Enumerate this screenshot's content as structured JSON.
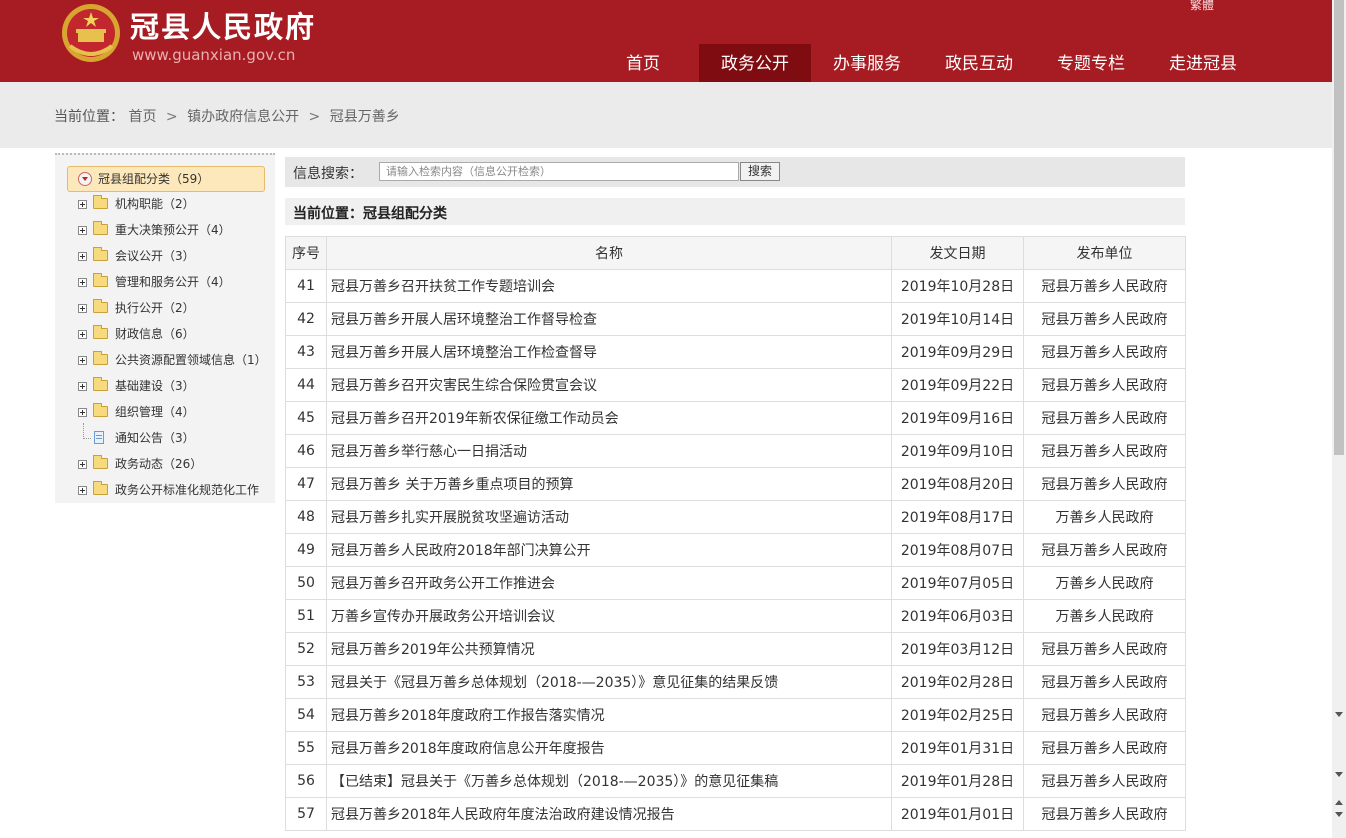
{
  "header": {
    "site_title": "冠县人民政府",
    "site_domain": "www.guanxian.gov.cn",
    "lang_link": "繁體",
    "nav": [
      {
        "label": "首页",
        "active": false
      },
      {
        "label": "政务公开",
        "active": true
      },
      {
        "label": "办事服务",
        "active": false
      },
      {
        "label": "政民互动",
        "active": false
      },
      {
        "label": "专题专栏",
        "active": false
      },
      {
        "label": "走进冠县",
        "active": false
      }
    ]
  },
  "breadcrumb": {
    "prefix": "当前位置：",
    "items": [
      "首页",
      "镇办政府信息公开",
      "冠县万善乡"
    ],
    "sep": ">"
  },
  "sidebar": {
    "root_label": "冠县组配分类（59）",
    "items": [
      {
        "label": "机构职能（2）",
        "type": "folder"
      },
      {
        "label": "重大决策预公开（4）",
        "type": "folder"
      },
      {
        "label": "会议公开（3）",
        "type": "folder"
      },
      {
        "label": "管理和服务公开（4）",
        "type": "folder"
      },
      {
        "label": "执行公开（2）",
        "type": "folder"
      },
      {
        "label": "财政信息（6）",
        "type": "folder"
      },
      {
        "label": "公共资源配置领域信息（1）",
        "type": "folder"
      },
      {
        "label": "基础建设（3）",
        "type": "folder"
      },
      {
        "label": "组织管理（4）",
        "type": "folder"
      },
      {
        "label": "通知公告（3）",
        "type": "doc"
      },
      {
        "label": "政务动态（26）",
        "type": "folder"
      },
      {
        "label": "政务公开标准化规范化工作",
        "type": "folder"
      }
    ]
  },
  "search": {
    "label": "信息搜索：",
    "placeholder": "请输入检索内容（信息公开检索）",
    "button": "搜索"
  },
  "location": {
    "text": "当前位置：冠县组配分类"
  },
  "table": {
    "headers": [
      "序号",
      "名称",
      "发文日期",
      "发布单位"
    ],
    "rows": [
      [
        "41",
        "冠县万善乡召开扶贫工作专题培训会",
        "2019年10月28日",
        "冠县万善乡人民政府"
      ],
      [
        "42",
        "冠县万善乡开展人居环境整治工作督导检查",
        "2019年10月14日",
        "冠县万善乡人民政府"
      ],
      [
        "43",
        "冠县万善乡开展人居环境整治工作检查督导",
        "2019年09月29日",
        "冠县万善乡人民政府"
      ],
      [
        "44",
        "冠县万善乡召开灾害民生综合保险贯宣会议",
        "2019年09月22日",
        "冠县万善乡人民政府"
      ],
      [
        "45",
        "冠县万善乡召开2019年新农保征缴工作动员会",
        "2019年09月16日",
        "冠县万善乡人民政府"
      ],
      [
        "46",
        "冠县万善乡举行慈心一日捐活动",
        "2019年09月10日",
        "冠县万善乡人民政府"
      ],
      [
        "47",
        "冠县万善乡 关于万善乡重点项目的预算",
        "2019年08月20日",
        "冠县万善乡人民政府"
      ],
      [
        "48",
        "冠县万善乡扎实开展脱贫攻坚遍访活动",
        "2019年08月17日",
        "万善乡人民政府"
      ],
      [
        "49",
        "冠县万善乡人民政府2018年部门决算公开",
        "2019年08月07日",
        "冠县万善乡人民政府"
      ],
      [
        "50",
        "冠县万善乡召开政务公开工作推进会",
        "2019年07月05日",
        "万善乡人民政府"
      ],
      [
        "51",
        "万善乡宣传办开展政务公开培训会议",
        "2019年06月03日",
        "万善乡人民政府"
      ],
      [
        "52",
        "冠县万善乡2019年公共预算情况",
        "2019年03月12日",
        "冠县万善乡人民政府"
      ],
      [
        "53",
        "冠县关于《冠县万善乡总体规划（2018-—2035）》意见征集的结果反馈",
        "2019年02月28日",
        "冠县万善乡人民政府"
      ],
      [
        "54",
        "冠县万善乡2018年度政府工作报告落实情况",
        "2019年02月25日",
        "冠县万善乡人民政府"
      ],
      [
        "55",
        "冠县万善乡2018年度政府信息公开年度报告",
        "2019年01月31日",
        "冠县万善乡人民政府"
      ],
      [
        "56",
        "【已结束】冠县关于《万善乡总体规划（2018-—2035）》的意见征集稿",
        "2019年01月28日",
        "冠县万善乡人民政府"
      ],
      [
        "57",
        "冠县万善乡2018年人民政府年度法治政府建设情况报告",
        "2019年01月01日",
        "冠县万善乡人民政府"
      ]
    ]
  }
}
